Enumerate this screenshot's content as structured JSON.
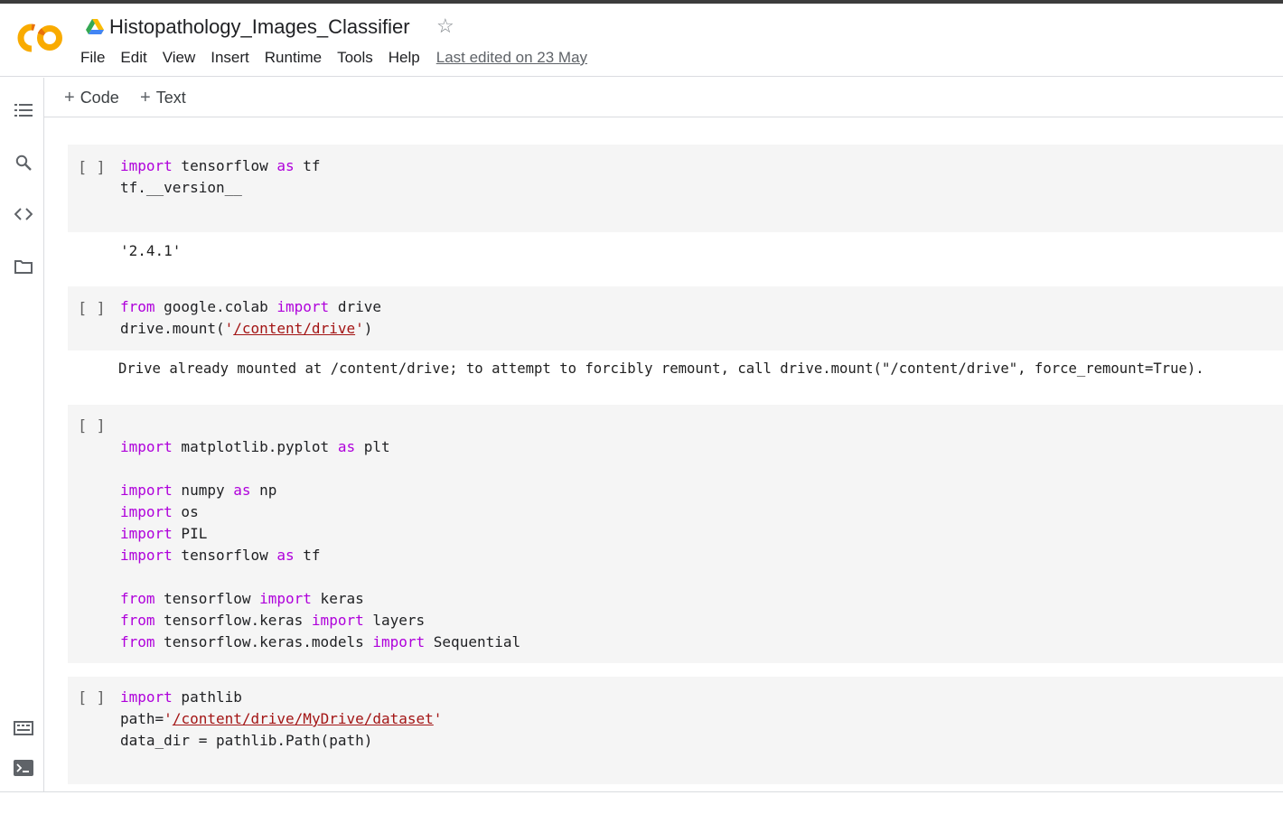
{
  "header": {
    "title": "Histopathology_Images_Classifier",
    "logo_text": "CO",
    "menu": [
      "File",
      "Edit",
      "View",
      "Insert",
      "Runtime",
      "Tools",
      "Help"
    ],
    "last_edited": "Last edited on 23 May",
    "brand_color": "#f9ab00"
  },
  "toolbar": {
    "add_code": "Code",
    "add_text": "Text"
  },
  "sidebar": {
    "icons": [
      "table-of-contents-icon",
      "search-icon",
      "code-snippets-icon",
      "files-folder-icon",
      "command-palette-icon",
      "terminal-icon"
    ]
  },
  "cells": [
    {
      "run_label": "[ ]",
      "lines": [
        {
          "kw": "import",
          "rest": " tensorflow ",
          "kw2": "as",
          "rest2": " tf"
        },
        {
          "plain": "tf.__version__"
        }
      ],
      "output": "'2.4.1'"
    },
    {
      "run_label": "[ ]",
      "line1": {
        "kw": "from",
        "mid": " google.colab ",
        "kw2": "import",
        "end": " drive"
      },
      "line2": {
        "pre": "drive.mount(",
        "q1": "'",
        "path": "/content/drive",
        "q2": "'",
        "post": ")"
      },
      "output": "Drive already mounted at /content/drive; to attempt to forcibly remount, call drive.mount(\"/content/drive\", force_remount=True)."
    },
    {
      "run_label": "[ ]",
      "imports": [
        {
          "kw": "import",
          "mod": " matplotlib.pyplot ",
          "kw2": "as",
          "alias": " plt"
        },
        {
          "kw": "import",
          "mod": " numpy ",
          "kw2": "as",
          "alias": " np"
        },
        {
          "kw": "import",
          "mod": " os",
          "kw2": "",
          "alias": ""
        },
        {
          "kw": "import",
          "mod": " PIL",
          "kw2": "",
          "alias": ""
        },
        {
          "kw": "import",
          "mod": " tensorflow ",
          "kw2": "as",
          "alias": " tf"
        },
        {
          "kw": "from",
          "mod": " tensorflow ",
          "kw2": "import",
          "alias": " keras"
        },
        {
          "kw": "from",
          "mod": " tensorflow.keras ",
          "kw2": "import",
          "alias": " layers"
        },
        {
          "kw": "from",
          "mod": " tensorflow.keras.models ",
          "kw2": "import",
          "alias": " Sequential"
        }
      ]
    },
    {
      "run_label": "[ ]",
      "line1": {
        "kw": "import",
        "rest": " pathlib"
      },
      "line2": {
        "pre": "path=",
        "q1": "'",
        "path": "/content/drive/MyDrive/dataset",
        "q2": "'"
      },
      "line3": "data_dir = pathlib.Path(path)"
    }
  ]
}
